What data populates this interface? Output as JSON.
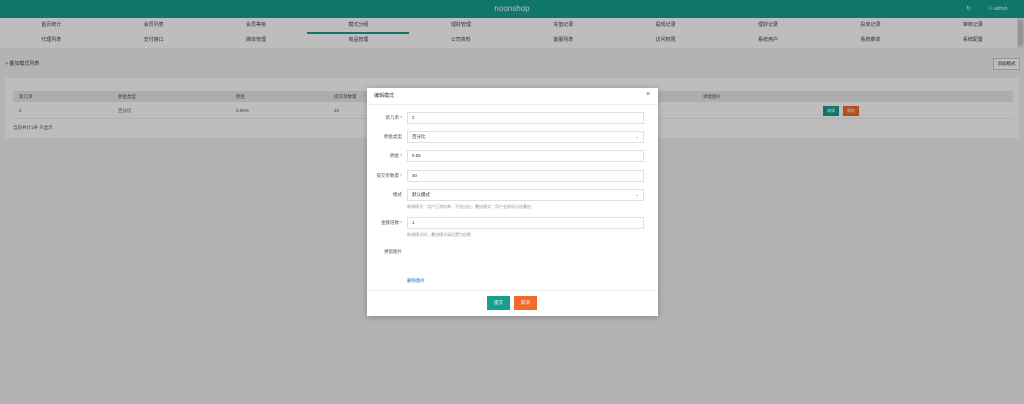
{
  "app": {
    "title": "noonshop",
    "user": "admin"
  },
  "nav": {
    "row1": [
      "首页统计",
      "会员列表",
      "会员等级",
      "模式分组",
      "理财管理",
      "充值记录",
      "提现记录",
      "理财记录",
      "投单记录",
      "审核记录"
    ],
    "row2": [
      "代理列表",
      "支付接口",
      "媒体管理",
      "商品管理",
      "公司资料",
      "客服列表",
      "访问权限",
      "系统用户",
      "系统菜单",
      "系统配置"
    ]
  },
  "page": {
    "breadcrumb": "> 叠加模式列表",
    "add_button": "添加模式"
  },
  "table": {
    "headers": [
      "第几单",
      "佣金类型",
      "佣金",
      "提交单数量",
      "",
      "弹窗图片"
    ],
    "rows": [
      {
        "cells": [
          "2",
          "百分比",
          "0.05%",
          "40"
        ],
        "edit": "编辑",
        "delete": "删除"
      }
    ],
    "footer": "当前共计1条 只显示"
  },
  "modal": {
    "title": "编辑模式",
    "close": "×",
    "fields": {
      "order_no": {
        "label": "第几单",
        "required": true,
        "value": "2"
      },
      "commission_type": {
        "label": "佣金类型",
        "required": false,
        "value": "百分比"
      },
      "commission": {
        "label": "佣金",
        "required": true,
        "value": "0.05"
      },
      "submit_count": {
        "label": "提交单数量",
        "required": true,
        "value": "40"
      },
      "mode": {
        "label": "模式",
        "required": false,
        "value": "默认模式",
        "hint": "新增模式：用户正常抢单，不会出红。叠加模式：用户会继续出现叠加"
      },
      "price_multiple": {
        "label": "金额倍数",
        "required": true,
        "value": "1",
        "hint": "新增模式时，叠加模式请设置为倍数"
      },
      "popup_image": {
        "label": "弹窗图片"
      }
    },
    "delete_image": "删除图片",
    "submit": "提交",
    "cancel": "取消"
  },
  "colors": {
    "brand": "#169f8f",
    "danger": "#f06a2c"
  }
}
